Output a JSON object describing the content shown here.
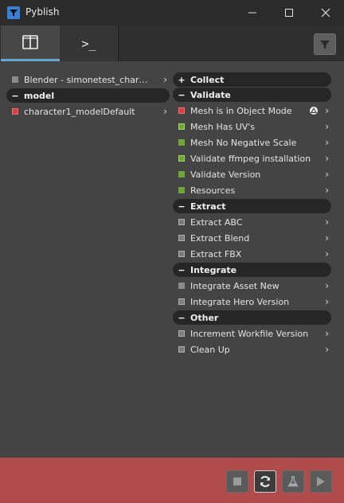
{
  "window": {
    "title": "Pyblish"
  },
  "tabs": {
    "terminal_glyph": ">_"
  },
  "instances": [
    {
      "label": "Blender - simonetest_charact...",
      "kind": "context"
    },
    {
      "label": "model",
      "kind": "section",
      "sign": "−"
    },
    {
      "label": "character1_modelDefault",
      "kind": "instance"
    }
  ],
  "plugins": {
    "collect": {
      "sign": "+",
      "title": "Collect"
    },
    "validate": {
      "sign": "−",
      "title": "Validate",
      "items": [
        "Mesh is in Object Mode",
        "Mesh Has UV's",
        "Mesh No Negative Scale",
        "Validate ffmpeg installation",
        "Validate Version",
        "Resources"
      ]
    },
    "extract": {
      "sign": "−",
      "title": "Extract",
      "items": [
        "Extract ABC",
        "Extract Blend",
        "Extract FBX"
      ]
    },
    "integrate": {
      "sign": "−",
      "title": "Integrate",
      "items": [
        "Integrate Asset New",
        "Integrate Hero Version"
      ]
    },
    "other": {
      "sign": "−",
      "title": "Other",
      "items": [
        "Increment Workfile Version",
        "Clean Up"
      ]
    }
  },
  "glyphs": {
    "chevron": "›"
  },
  "colors": {
    "error": "#d64040",
    "success": "#6fa536",
    "footer_error": "#b04c4c",
    "accent": "#68a5d0"
  }
}
